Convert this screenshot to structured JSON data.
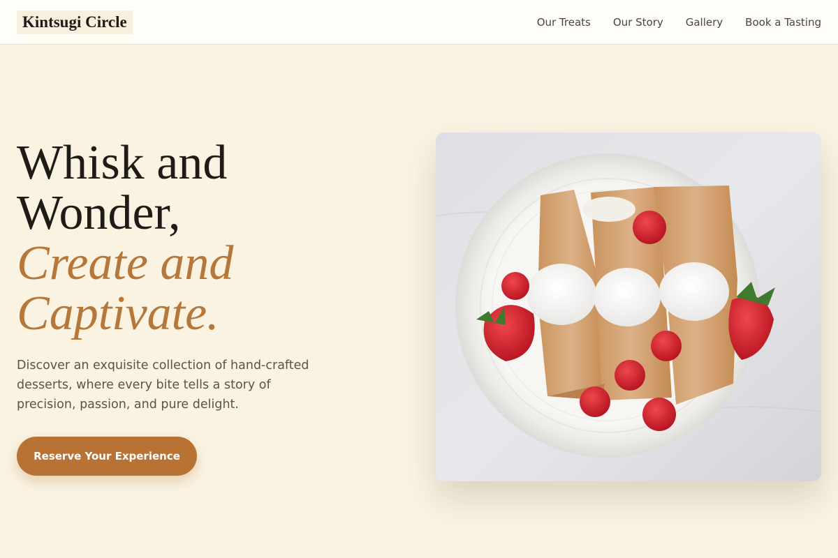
{
  "header": {
    "logo": "Kintsugi Circle",
    "nav": [
      "Our Treats",
      "Our Story",
      "Gallery",
      "Book a Tasting"
    ]
  },
  "hero": {
    "title_lines": [
      "Whisk and",
      "Wonder,"
    ],
    "accent_lines": [
      "Create and",
      "Captivate."
    ],
    "description": "Discover an exquisite collection of hand-crafted desserts, where every bite tells a story of precision, passion, and pure delight.",
    "cta_label": "Reserve Your Experience"
  },
  "image": {
    "subject": "crepes with whipped cream, strawberries and raspberries on a white plate"
  },
  "colors": {
    "background": "#faf3e2",
    "accent": "#b5773a",
    "button": "#b87334",
    "text": "#1f1b17"
  }
}
